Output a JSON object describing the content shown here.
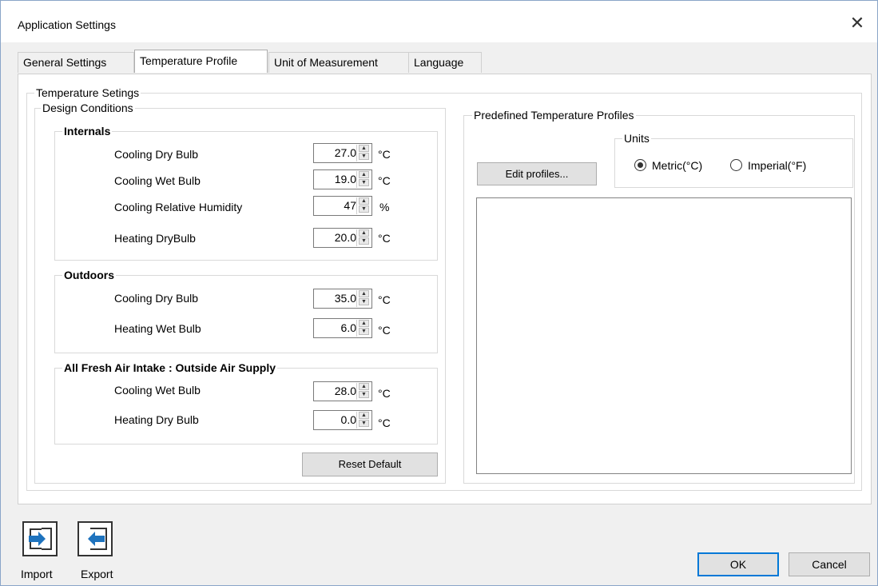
{
  "window": {
    "title": "Application Settings",
    "close_glyph": "✕"
  },
  "tabs": [
    {
      "label": "General Settings"
    },
    {
      "label": "Temperature Profile"
    },
    {
      "label": "Unit of Measurement"
    },
    {
      "label": "Language"
    }
  ],
  "temperature": {
    "group_title": "Temperature Setings",
    "design_title": "Design Conditions",
    "internals": {
      "title": "Internals",
      "rows": [
        {
          "label": "Cooling Dry Bulb",
          "value": "27.0",
          "unit": "°C"
        },
        {
          "label": "Cooling Wet Bulb",
          "value": "19.0",
          "unit": "°C"
        },
        {
          "label": "Cooling Relative Humidity",
          "value": "47",
          "unit": "%"
        },
        {
          "label": "Heating DryBulb",
          "value": "20.0",
          "unit": "°C"
        }
      ]
    },
    "outdoors": {
      "title": "Outdoors",
      "rows": [
        {
          "label": "Cooling Dry Bulb",
          "value": "35.0",
          "unit": "°C"
        },
        {
          "label": "Heating Wet Bulb",
          "value": "6.0",
          "unit": "°C"
        }
      ]
    },
    "fresh_air": {
      "title": "All Fresh Air Intake :  Outside Air Supply",
      "rows": [
        {
          "label": "Cooling Wet Bulb",
          "value": "28.0",
          "unit": "°C"
        },
        {
          "label": "Heating Dry Bulb",
          "value": "0.0",
          "unit": "°C"
        }
      ]
    },
    "reset_button": "Reset Default"
  },
  "profiles": {
    "title": "Predefined Temperature Profiles",
    "edit_button": "Edit profiles...",
    "units_title": "Units",
    "metric_label": "Metric(°C)",
    "imperial_label": "Imperial(°F)",
    "selected_unit": "metric"
  },
  "footer": {
    "import_label": "Import",
    "export_label": "Export",
    "ok_label": "OK",
    "cancel_label": "Cancel"
  },
  "colors": {
    "icon_blue": "#1e73be",
    "accent": "#0078d7"
  }
}
